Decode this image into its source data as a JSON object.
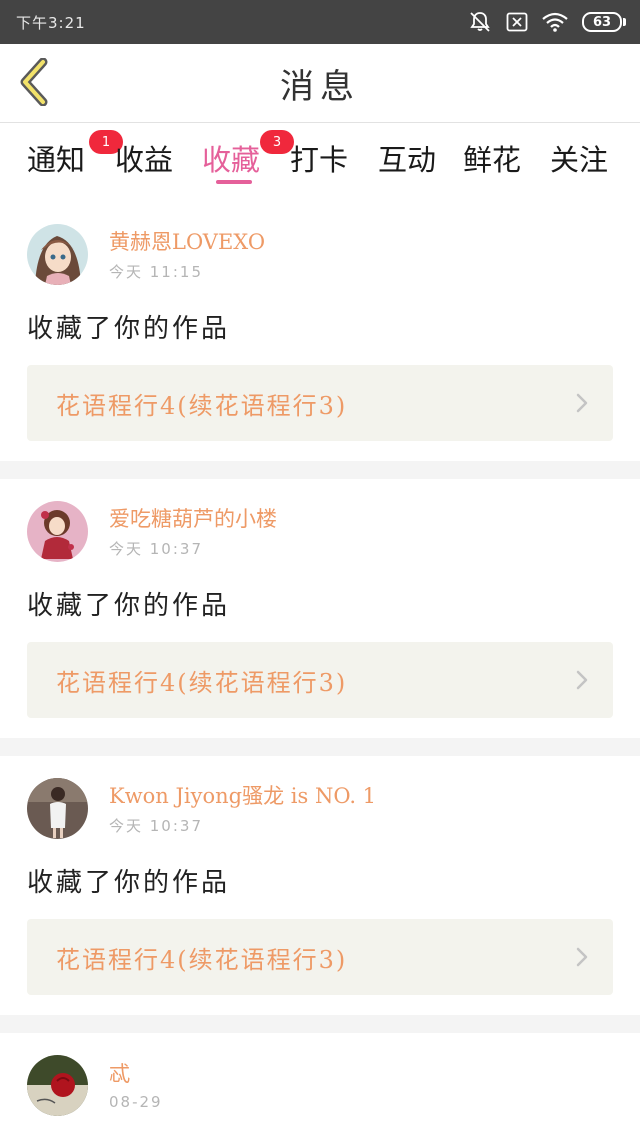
{
  "status": {
    "time": "下午3:21",
    "battery": "63"
  },
  "header": {
    "title": "消息"
  },
  "tabs": [
    {
      "label": "通知",
      "badge": "1"
    },
    {
      "label": "收益",
      "badge": ""
    },
    {
      "label": "收藏",
      "badge": "3",
      "active": true
    },
    {
      "label": "打卡",
      "badge": ""
    },
    {
      "label": "互动",
      "badge": ""
    },
    {
      "label": "鲜花",
      "badge": ""
    },
    {
      "label": "关注",
      "badge": ""
    }
  ],
  "cards": [
    {
      "name": "黄赫恩LOVEXO",
      "time": "今天 11:15",
      "action": "收藏了你的作品",
      "work": "花语程行4(续花语程行3)"
    },
    {
      "name": "爱吃糖葫芦的小楼",
      "time": "今天 10:37",
      "action": "收藏了你的作品",
      "work": "花语程行4(续花语程行3)"
    },
    {
      "name": "Kwon Jiyong骚龙 is NO. 1",
      "time": "今天 10:37",
      "action": "收藏了你的作品",
      "work": "花语程行4(续花语程行3)"
    },
    {
      "name": "忒",
      "time": "08-29",
      "action": "",
      "work": ""
    }
  ],
  "colors": {
    "accent": "#e5609a",
    "name": "#ee9a66",
    "badge": "#f0283c",
    "status_bar": "#444444"
  }
}
